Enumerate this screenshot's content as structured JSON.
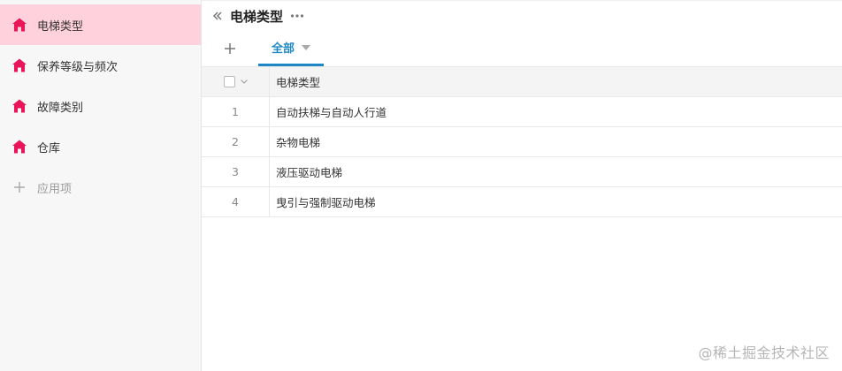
{
  "sidebar": {
    "items": [
      {
        "label": "电梯类型",
        "active": true
      },
      {
        "label": "保养等级与频次",
        "active": false
      },
      {
        "label": "故障类别",
        "active": false
      },
      {
        "label": "仓库",
        "active": false
      }
    ],
    "add_label": "应用项",
    "icon": "home-icon",
    "icon_color": "#e8155a"
  },
  "header": {
    "title": "电梯类型"
  },
  "tabs": {
    "active_label": "全部",
    "accent": "#1e88c7"
  },
  "table": {
    "column_header": "电梯类型",
    "rows": [
      {
        "index": "1",
        "name": "自动扶梯与自动人行道"
      },
      {
        "index": "2",
        "name": "杂物电梯"
      },
      {
        "index": "3",
        "name": "液压驱动电梯"
      },
      {
        "index": "4",
        "name": "曳引与强制驱动电梯"
      }
    ]
  },
  "watermark": "@稀土掘金技术社区"
}
